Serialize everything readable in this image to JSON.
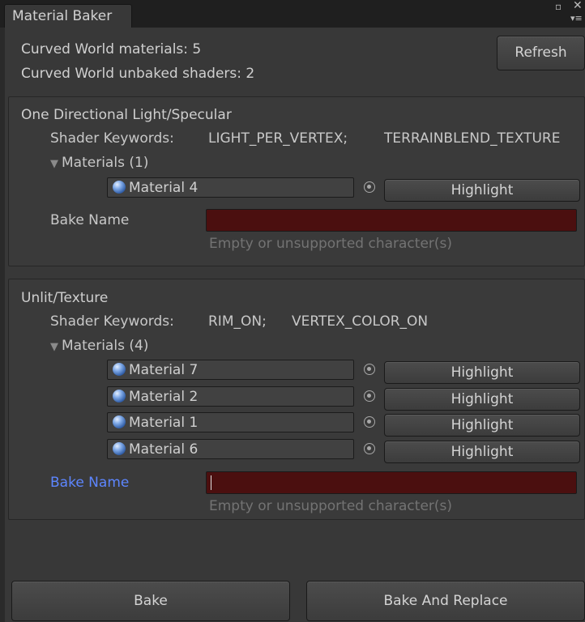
{
  "window": {
    "title": "Material Baker"
  },
  "stats": {
    "materials_label": "Curved World materials: 5",
    "unbaked_label": "Curved World unbaked shaders: 2"
  },
  "refresh_label": "Refresh",
  "sections": [
    {
      "shader_name": "One Directional Light/Specular",
      "keywords_label": "Shader Keywords:",
      "keywords": [
        "LIGHT_PER_VERTEX;",
        "TERRAINBLEND_TEXTURE"
      ],
      "materials_header": "Materials (1)",
      "materials": [
        {
          "name": "Material 4",
          "button": "Highlight"
        }
      ],
      "bake_name_label": "Bake Name",
      "bake_name_value": "",
      "error": "Empty or unsupported character(s)"
    },
    {
      "shader_name": "Unlit/Texture",
      "keywords_label": "Shader Keywords:",
      "keywords": [
        "RIM_ON;",
        "VERTEX_COLOR_ON"
      ],
      "materials_header": "Materials (4)",
      "materials": [
        {
          "name": "Material 7",
          "button": "Highlight"
        },
        {
          "name": "Material 2",
          "button": "Highlight"
        },
        {
          "name": "Material 1",
          "button": "Highlight"
        },
        {
          "name": "Material 6",
          "button": "Highlight"
        }
      ],
      "bake_name_label": "Bake Name",
      "bake_name_value": "",
      "error": "Empty or unsupported character(s)"
    }
  ],
  "footer": {
    "bake_label": "Bake",
    "bake_replace_label": "Bake And Replace"
  },
  "icons": {
    "material": "material-sphere-icon",
    "picker": "object-picker-icon",
    "foldout": "foldout-triangle-icon"
  },
  "colors": {
    "bake_name_error_bg": "#4b0f0f",
    "focused_label": "#5d86ff",
    "hint_text": "#737373"
  }
}
